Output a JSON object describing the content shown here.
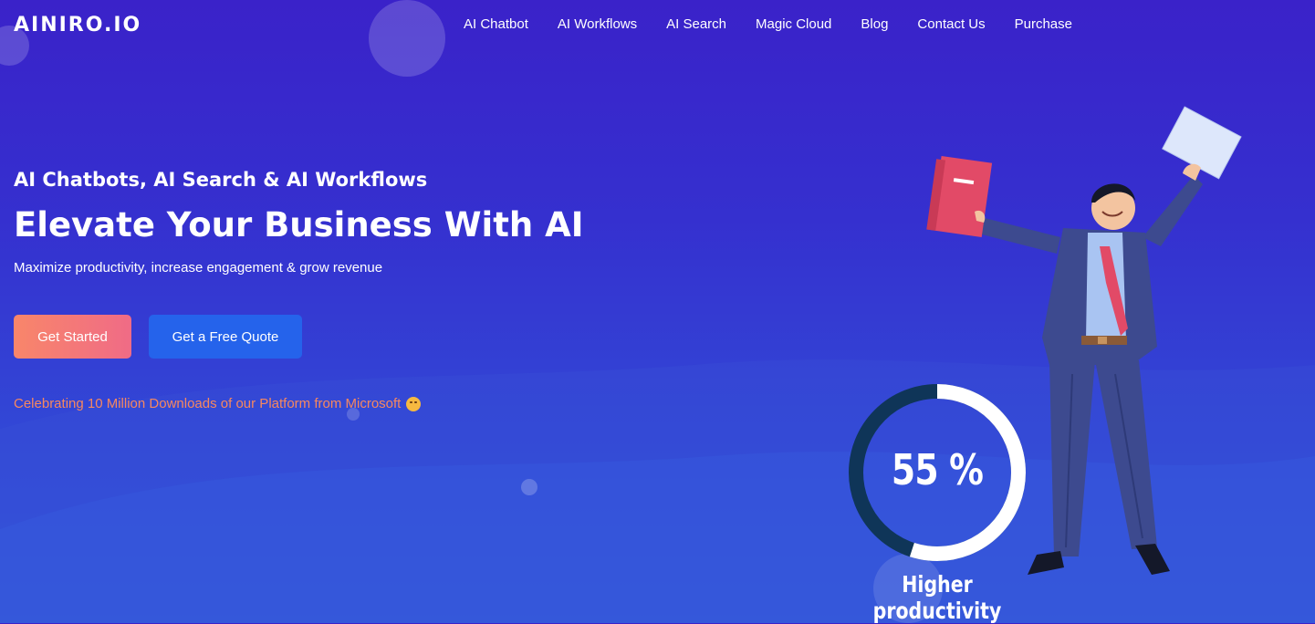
{
  "brand": {
    "logo_text": "AINIRO.IO"
  },
  "nav": {
    "items": [
      {
        "label": "AI Chatbot"
      },
      {
        "label": "AI Workflows"
      },
      {
        "label": "AI Search"
      },
      {
        "label": "Magic Cloud"
      },
      {
        "label": "Blog"
      },
      {
        "label": "Contact Us"
      },
      {
        "label": "Purchase"
      }
    ]
  },
  "hero": {
    "subtitle": "AI Chatbots, AI Search & AI Workflows",
    "title": "Elevate Your Business With AI",
    "tagline": "Maximize productivity, increase engagement & grow revenue",
    "primary_button": "Get Started",
    "secondary_button": "Get a Free Quote",
    "announcement": "Celebrating 10 Million Downloads of our Platform from Microsoft"
  },
  "stat": {
    "value_text": "55 %",
    "progress_percent": 55,
    "caption": "Higher productivity"
  },
  "colors": {
    "primary_button_start": "#f8866a",
    "primary_button_end": "#f06b86",
    "secondary_button": "#2563eb",
    "announcement": "#f7885f",
    "gauge_track": "#0f3558",
    "gauge_fill": "#ffffff"
  },
  "icons": {
    "announcement_emoji": "kissing-face-emoji"
  }
}
